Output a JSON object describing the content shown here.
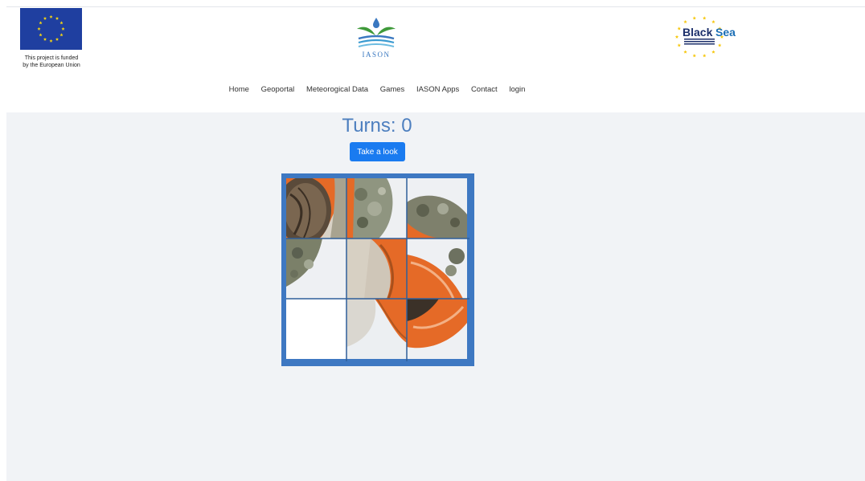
{
  "header": {
    "eu_caption_line1": "This project is funded",
    "eu_caption_line2": "by the European Union",
    "iason_text": "IASON",
    "blacksea_text_1": "Black",
    "blacksea_text_2": "Sea"
  },
  "nav": {
    "items": [
      "Home",
      "Geoportal",
      "Meteorogical Data",
      "Games",
      "IASON Apps",
      "Contact",
      "login"
    ]
  },
  "game": {
    "turns_label": "Turns: 0",
    "look_button": "Take a look",
    "blank_tile_index": 6
  },
  "colors": {
    "accent": "#3e78c2",
    "button": "#1a7bf0",
    "turns_text": "#4d7fbf",
    "background": "#f1f3f6"
  }
}
